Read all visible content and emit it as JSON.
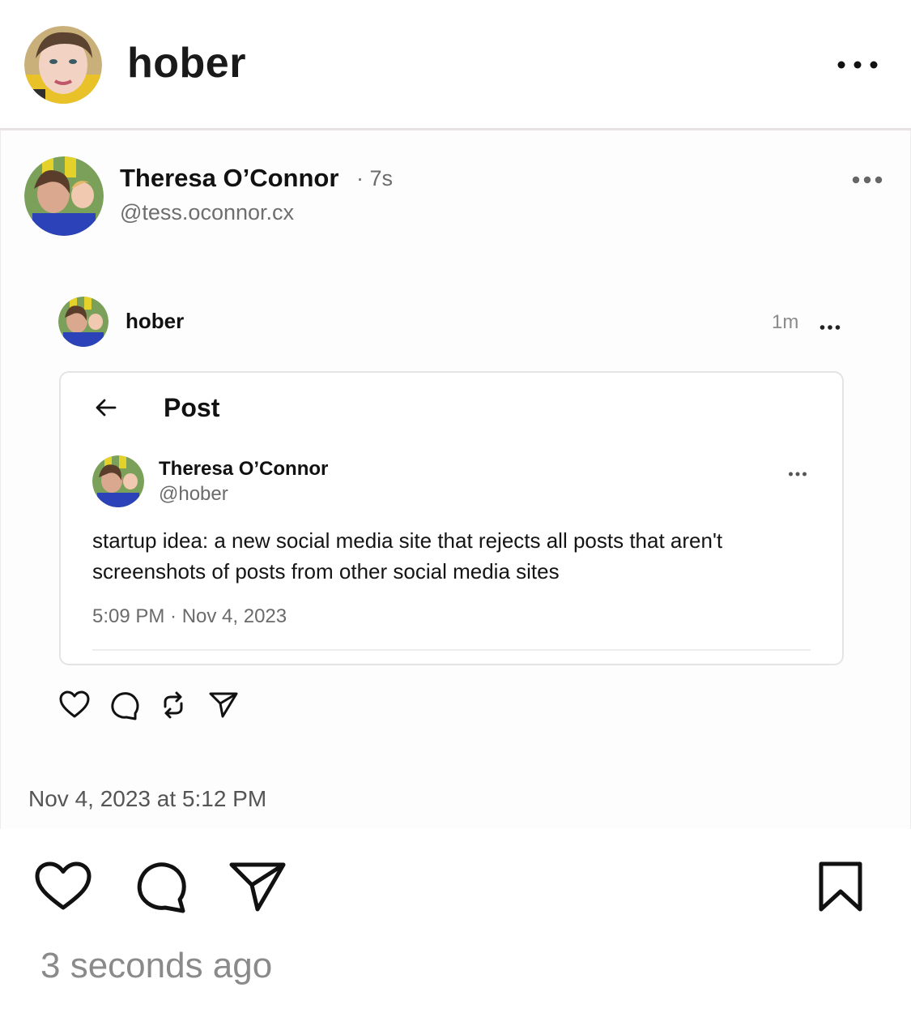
{
  "header": {
    "username": "hober",
    "more_icon": "ellipsis-horizontal-icon"
  },
  "post": {
    "author_name": "Theresa O’Connor",
    "author_time": "· 7s",
    "author_handle": "@tess.oconnor.cx",
    "inner": {
      "name": "hober",
      "time": "1m"
    },
    "card": {
      "title": "Post",
      "name": "Theresa O’Connor",
      "handle": "@hober",
      "text": "startup idea: a new social media site that rejects all posts that aren't screenshots of posts from other social media sites",
      "date": "5:09 PM · Nov 4, 2023"
    },
    "inner_actions": [
      "heart-icon",
      "comment-icon",
      "repost-icon",
      "share-icon"
    ],
    "timestamp": "Nov 4, 2023 at 5:12 PM"
  },
  "actions": {
    "icons": [
      "heart-icon",
      "comment-icon",
      "send-icon",
      "bookmark-icon"
    ],
    "relative_time": "3 seconds ago"
  },
  "colors": {
    "text_primary": "#111111",
    "text_secondary": "#6b6b6b",
    "timestamp": "#8a8a8a",
    "border": "#e4e4e4"
  }
}
